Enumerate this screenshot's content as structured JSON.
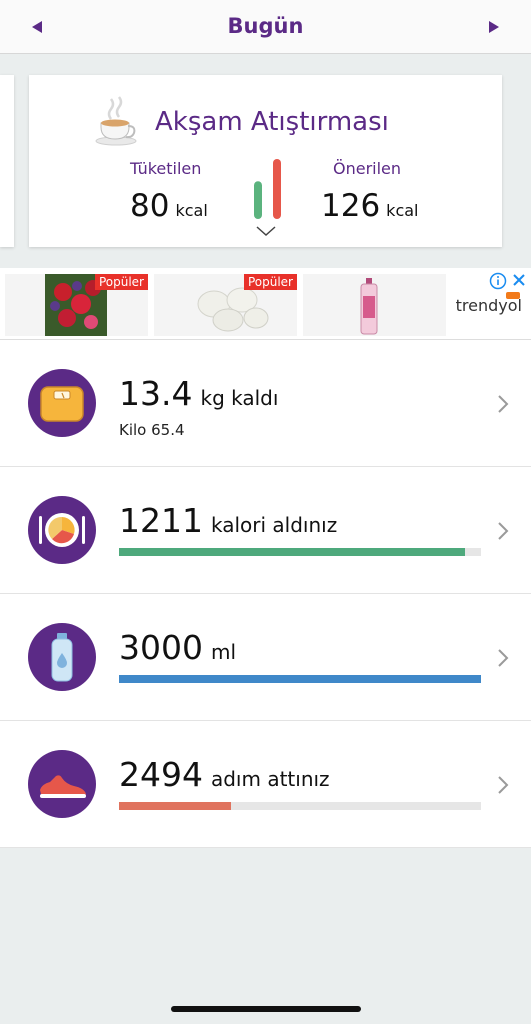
{
  "header": {
    "title": "Bugün",
    "prev_icon": "triangle-left-icon",
    "next_icon": "triangle-right-icon",
    "accent": "#5b2a86"
  },
  "meal_card": {
    "title": "Akşam Atıştırması",
    "icon": "tea-cup-icon",
    "consumed_label": "Tüketilen",
    "consumed_value": "80",
    "consumed_unit": "kcal",
    "recommended_label": "Önerilen",
    "recommended_value": "126",
    "recommended_unit": "kcal",
    "consumed_fraction": 0.63,
    "consumed_color": "#5bb37e",
    "recommended_color": "#e6574a"
  },
  "ad": {
    "badge_a": "Popüler",
    "badge_b": "Popüler",
    "brand": "trendyol",
    "info_icon": "info-icon",
    "close_icon": "close-icon"
  },
  "stats": {
    "weight": {
      "value": "13.4",
      "unit": "kg kaldı",
      "sub": "Kilo 65.4",
      "icon": "scale-icon"
    },
    "calories": {
      "value": "1211",
      "unit": "kalori aldınız",
      "progress": 0.955,
      "color": "#4ea97c",
      "icon": "plate-icon"
    },
    "water": {
      "value": "3000",
      "unit": "ml",
      "progress": 1.0,
      "color": "#3f88c9",
      "icon": "water-bottle-icon"
    },
    "steps": {
      "value": "2494",
      "unit": "adım attınız",
      "progress": 0.31,
      "color": "#e0735e",
      "icon": "sneaker-icon"
    }
  }
}
